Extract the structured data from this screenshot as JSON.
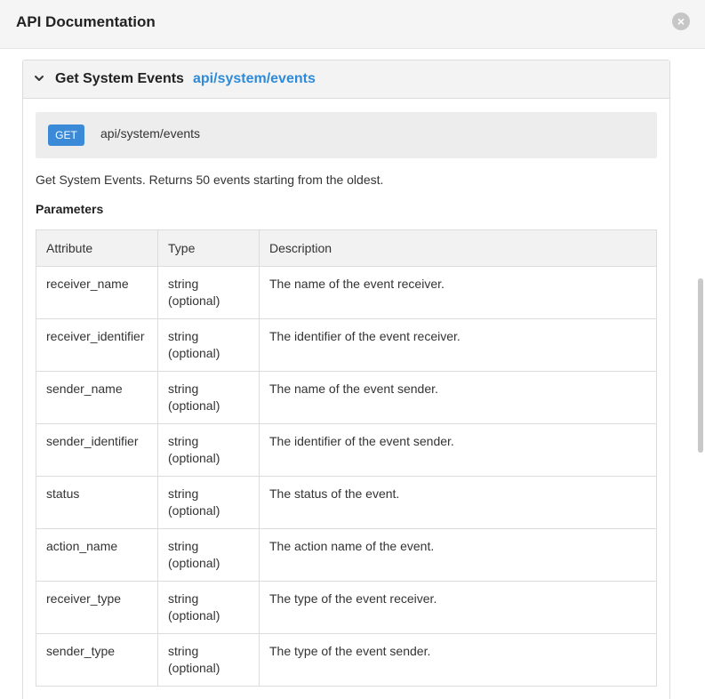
{
  "header": {
    "title": "API Documentation",
    "close_icon": "×"
  },
  "panel": {
    "title": "Get System Events",
    "path": "api/system/events"
  },
  "endpoint": {
    "method": "GET",
    "path": "api/system/events"
  },
  "description": "Get System Events. Returns 50 events starting from the oldest.",
  "parameters": {
    "title": "Parameters",
    "headers": [
      "Attribute",
      "Type",
      "Description"
    ],
    "rows": [
      {
        "attribute": "receiver_name",
        "type": "string",
        "type_note": "(optional)",
        "description": "The name of the event receiver."
      },
      {
        "attribute": "receiver_identifier",
        "type": "string",
        "type_note": "(optional)",
        "description": "The identifier of the event receiver."
      },
      {
        "attribute": "sender_name",
        "type": "string",
        "type_note": "(optional)",
        "description": "The name of the event sender."
      },
      {
        "attribute": "sender_identifier",
        "type": "string",
        "type_note": "(optional)",
        "description": "The identifier of the event sender."
      },
      {
        "attribute": "status",
        "type": "string",
        "type_note": "(optional)",
        "description": "The status of the event."
      },
      {
        "attribute": "action_name",
        "type": "string",
        "type_note": "(optional)",
        "description": "The action name of the event."
      },
      {
        "attribute": "receiver_type",
        "type": "string",
        "type_note": "(optional)",
        "description": "The type of the event receiver."
      },
      {
        "attribute": "sender_type",
        "type": "string",
        "type_note": "(optional)",
        "description": "The type of the event sender."
      }
    ]
  },
  "colors": {
    "accent": "#2f8bd9",
    "method_badge": "#3a8ad8"
  }
}
